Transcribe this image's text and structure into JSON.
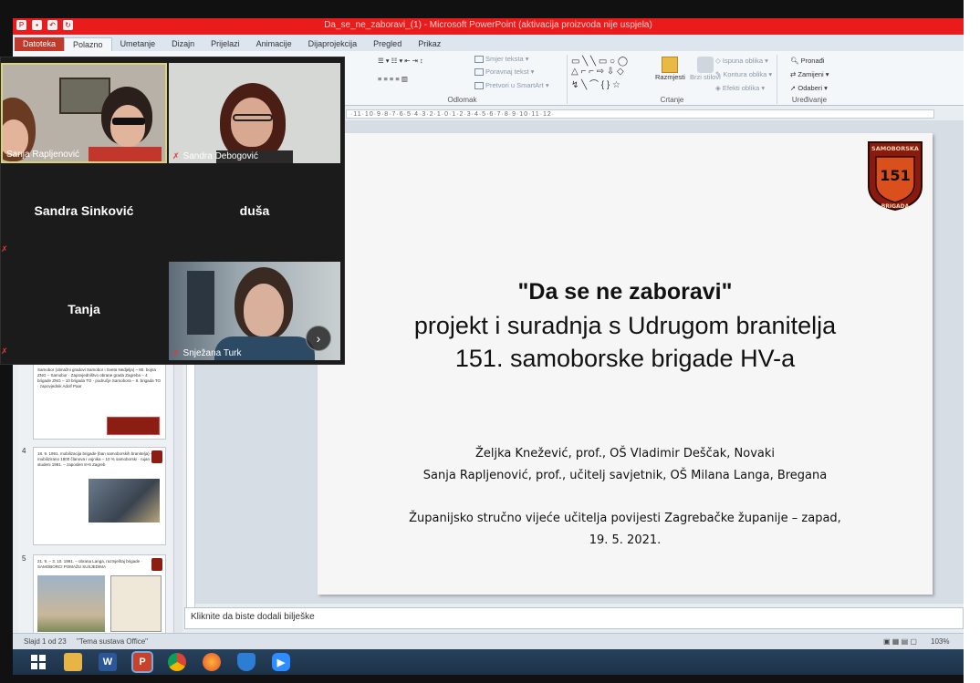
{
  "powerpoint": {
    "title": "Da_se_ne_zaboravi_(1) - Microsoft PowerPoint (aktivacija proizvoda nije uspjela)",
    "tabs": [
      "Datoteka",
      "Polazno",
      "Umetanje",
      "Dizajn",
      "Prijelazi",
      "Animacije",
      "Dijaprojekcija",
      "Pregled",
      "Prikaz"
    ],
    "active_tab": "Polazno",
    "ribbon": {
      "paragraph_label": "Odlomak",
      "text_direction": "Smjer teksta",
      "align_text": "Poravnaj tekst",
      "smartart": "Pretvori u SmartArt",
      "drawing_label": "Crtanje",
      "arrange": "Razmjesti",
      "quick_styles": "Brzi stilovi",
      "shape_fill": "Ispuna oblika",
      "shape_outline": "Kontura oblika",
      "shape_effects": "Efekti oblika",
      "editing_label": "Uređivanje",
      "find": "Pronađi",
      "replace": "Zamijeni",
      "select": "Odaberi"
    },
    "ruler_text": "·11·10·9·8·7·6·5·4·3·2·1·0·1·2·3·4·5·6·7·8·9·10·11·12·",
    "slide": {
      "headline": "\"Da se ne zaboravi\"",
      "line2": "projekt i suradnja s Udrugom branitelja",
      "line3": "151. samoborske brigade HV-a",
      "author1": "Željka  Knežević, prof., OŠ Vladimir Deščak, Novaki",
      "author2": "Sanja Rapljenović, prof., učitelj savjetnik, OŠ Milana Langa, Bregana",
      "event": "Županijsko stručno vijeće učitelja povijesti Zagrebačke županije – zapad,",
      "date": "19. 5. 2021.",
      "emblem_top": "SAMOBORSKA",
      "emblem_num": "151",
      "emblem_bottom": "BRIGADA"
    },
    "notes_placeholder": "Kliknite da biste dodali bilješke",
    "thumbnails": [
      {
        "num": "",
        "text": "Samobor (obnažni gradovi Samobor i Sveta Nedjelja) – 80. bojna ZNG – Samobor · Zapovjedništvo obrane grada Zagreba – 4 brigade ZNG – 10 brigada TO · područje Samobora – 8. brigada TO · zapovjednik Adolf Paar"
      },
      {
        "num": "4",
        "text": "18. 9. 1991. mobilizacija brigade (ban samoborskih branitelja) – mobilizirano 1800 članova i vojnika – 10 % samoborski · rujan – studeni 1991. – zaposlen 8+6 Zagreb"
      },
      {
        "num": "5",
        "text": "21. 9. – 3. 10. 1991. – obrana Langa, razmještaj brigade · SAMOBORCI POMAŽU SUSJEDIMA"
      }
    ],
    "status": {
      "slide": "Slajd 1 od 23",
      "theme": "\"Tema sustava Office\"",
      "zoom": "103%"
    }
  },
  "call": {
    "participants": [
      {
        "name": "Sanja Rapljenović",
        "video": true,
        "muted": false
      },
      {
        "name": "Sandra Debogović",
        "video": true,
        "muted": true
      },
      {
        "name": "Sandra Sinković",
        "video": false
      },
      {
        "name": "duša",
        "video": false
      },
      {
        "name": "Tanja",
        "video": false
      },
      {
        "name": "Snježana Turk",
        "video": true,
        "muted": true
      }
    ]
  },
  "taskbar": {
    "apps": [
      "start-icon",
      "explorer-icon",
      "word-icon",
      "powerpoint-icon",
      "chrome-icon",
      "firefox-icon",
      "shield-icon",
      "zoom-icon"
    ],
    "word_letter": "W",
    "ppt_letter": "P"
  },
  "colors": {
    "title_red": "#e81c1c",
    "file_tab": "#c0392b",
    "mute_red": "#e53935",
    "taskbar": "#27415c"
  }
}
